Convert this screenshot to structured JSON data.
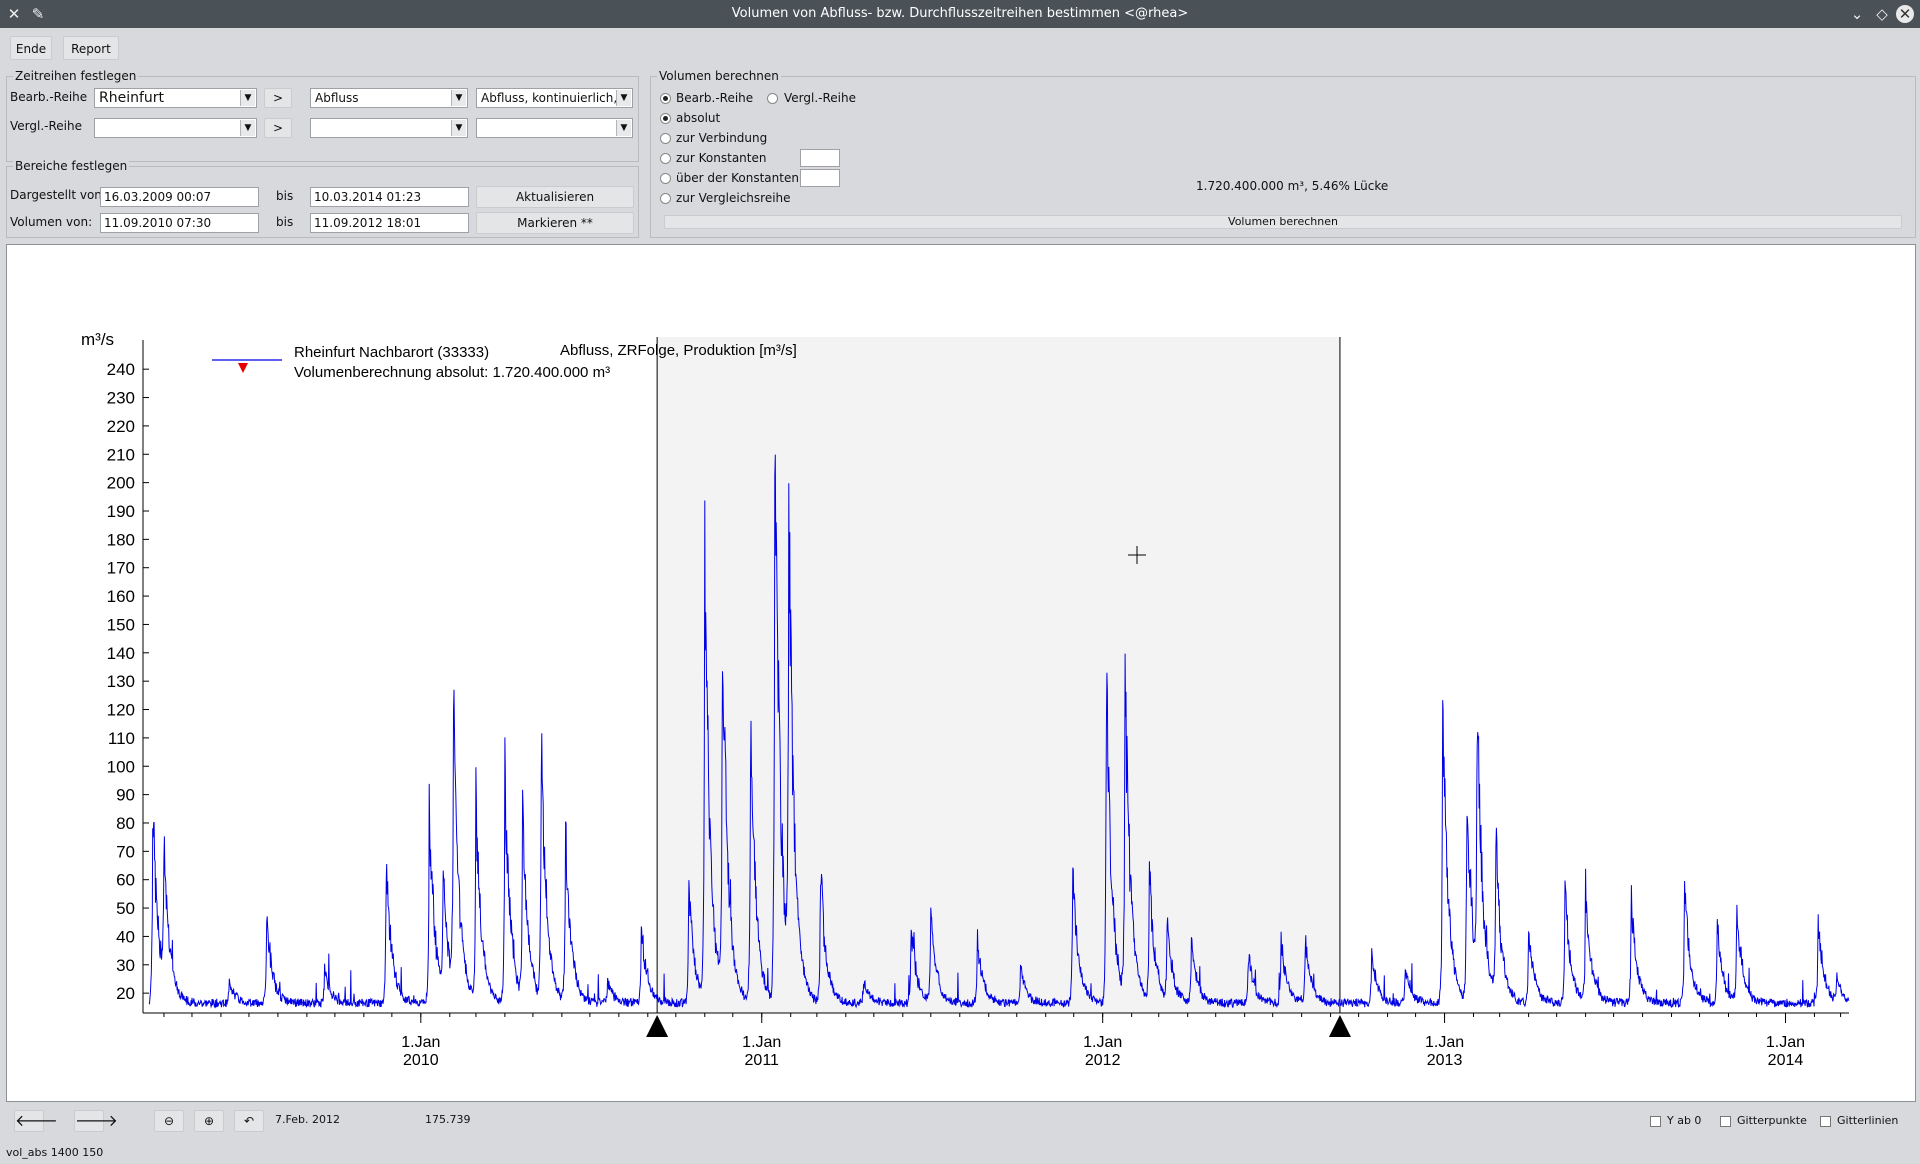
{
  "window": {
    "title": "Volumen von Abfluss- bzw. Durchflusszeitreihen bestimmen <@rhea>"
  },
  "toolbar": {
    "end_label": "Ende",
    "report_label": "Report"
  },
  "series_group": {
    "title": "Zeitreihen festlegen",
    "bearb_label": "Bearb.-Reihe",
    "bearb_station": "Rheinfurt",
    "bearb_type": "Abfluss",
    "bearb_variant": "Abfluss, kontinuierlich, Z",
    "vergl_label": "Vergl.-Reihe",
    "vergl_station": "",
    "vergl_type": "",
    "vergl_variant": "",
    "arrow_label": ">"
  },
  "range_group": {
    "title": "Bereiche festlegen",
    "shown_label": "Dargestellt von:",
    "shown_from": "16.03.2009 00:07",
    "bis_label": "bis",
    "shown_to": "10.03.2014 01:23",
    "refresh_label": "Aktualisieren",
    "volume_label": "Volumen von:",
    "volume_from": "11.09.2010 07:30",
    "volume_to": "11.09.2012 18:01",
    "mark_label": "Markieren **"
  },
  "volume_group": {
    "title": "Volumen berechnen",
    "opt_bearb": "Bearb.-Reihe",
    "opt_vergl": "Vergl.-Reihe",
    "opt_absolut": "absolut",
    "opt_verbindung": "zur Verbindung",
    "opt_konstanten": "zur Konstanten",
    "opt_ueber": "über der Konstanten",
    "opt_vergleich": "zur Vergleichsreihe",
    "konst_value": "",
    "ueber_value": "",
    "result": "1.720.400.000 m³, 5.46% Lücke",
    "calc_label": "Volumen berechnen"
  },
  "chart_data": {
    "type": "line",
    "title": "Abfluss, ZRFolge, Produktion [m³/s]",
    "ylabel": "m³/s",
    "ylim": [
      13,
      245
    ],
    "yticks": [
      20,
      30,
      40,
      50,
      60,
      70,
      80,
      90,
      100,
      110,
      120,
      130,
      140,
      150,
      160,
      170,
      180,
      190,
      200,
      210,
      220,
      230,
      240
    ],
    "xlim": [
      "2009-03-16",
      "2014-03-10"
    ],
    "xticks": [
      {
        "date": "2010-01-01",
        "day": "1.Jan",
        "year": "2010"
      },
      {
        "date": "2011-01-01",
        "day": "1.Jan",
        "year": "2011"
      },
      {
        "date": "2012-01-01",
        "day": "1.Jan",
        "year": "2012"
      },
      {
        "date": "2013-01-01",
        "day": "1.Jan",
        "year": "2013"
      },
      {
        "date": "2014-01-01",
        "day": "1.Jan",
        "year": "2014"
      }
    ],
    "legend": {
      "series_name": "Rheinfurt Nachbarort (33333)",
      "note": "Volumenberechnung absolut: 1.720.400.000 m³",
      "placement": "top-left"
    },
    "selection": {
      "from": "2010-09-11",
      "to": "2012-09-11"
    },
    "series": [
      {
        "name": "Rheinfurt Nachbarort (33333)",
        "color": "#0000e6",
        "peaks": [
          [
            "2009-03-20",
            92
          ],
          [
            "2009-04-01",
            70
          ],
          [
            "2009-06-10",
            25
          ],
          [
            "2009-07-20",
            50
          ],
          [
            "2009-09-20",
            30
          ],
          [
            "2009-11-25",
            70
          ],
          [
            "2010-01-10",
            92
          ],
          [
            "2010-01-25",
            60
          ],
          [
            "2010-02-05",
            122
          ],
          [
            "2010-03-01",
            90
          ],
          [
            "2010-04-01",
            103
          ],
          [
            "2010-04-20",
            85
          ],
          [
            "2010-05-10",
            112
          ],
          [
            "2010-06-05",
            80
          ],
          [
            "2010-07-20",
            25
          ],
          [
            "2010-08-25",
            45
          ],
          [
            "2010-10-15",
            60
          ],
          [
            "2010-11-01",
            185
          ],
          [
            "2010-11-20",
            150
          ],
          [
            "2010-12-20",
            120
          ],
          [
            "2011-01-15",
            234
          ],
          [
            "2011-01-30",
            180
          ],
          [
            "2011-03-05",
            65
          ],
          [
            "2011-04-20",
            25
          ],
          [
            "2011-06-10",
            45
          ],
          [
            "2011-07-01",
            50
          ],
          [
            "2011-08-20",
            40
          ],
          [
            "2011-10-05",
            30
          ],
          [
            "2011-11-30",
            65
          ],
          [
            "2012-01-05",
            137
          ],
          [
            "2012-01-25",
            135
          ],
          [
            "2012-02-20",
            65
          ],
          [
            "2012-03-10",
            45
          ],
          [
            "2012-04-05",
            40
          ],
          [
            "2012-06-05",
            35
          ],
          [
            "2012-07-10",
            40
          ],
          [
            "2012-08-05",
            40
          ],
          [
            "2012-10-15",
            35
          ],
          [
            "2012-11-20",
            30
          ],
          [
            "2012-12-30",
            126
          ],
          [
            "2013-01-25",
            100
          ],
          [
            "2013-02-05",
            118
          ],
          [
            "2013-02-25",
            75
          ],
          [
            "2013-04-01",
            45
          ],
          [
            "2013-05-10",
            60
          ],
          [
            "2013-06-01",
            60
          ],
          [
            "2013-07-20",
            55
          ],
          [
            "2013-09-15",
            60
          ],
          [
            "2013-10-20",
            45
          ],
          [
            "2013-11-10",
            52
          ],
          [
            "2014-02-05",
            48
          ],
          [
            "2014-02-25",
            25
          ]
        ]
      }
    ]
  },
  "status": {
    "cursor_date": "7.Feb. 2012",
    "cursor_value": "175.739",
    "y_from_zero": "Y ab 0",
    "grid_points": "Gitterpunkte",
    "grid_lines": "Gitterlinien",
    "footer": "vol_abs   1400 150"
  },
  "colors": {
    "accent": "#0000e6",
    "selection_bg": "#f3f3f3",
    "marker": "#000000",
    "legend_marker": "#e60000"
  }
}
